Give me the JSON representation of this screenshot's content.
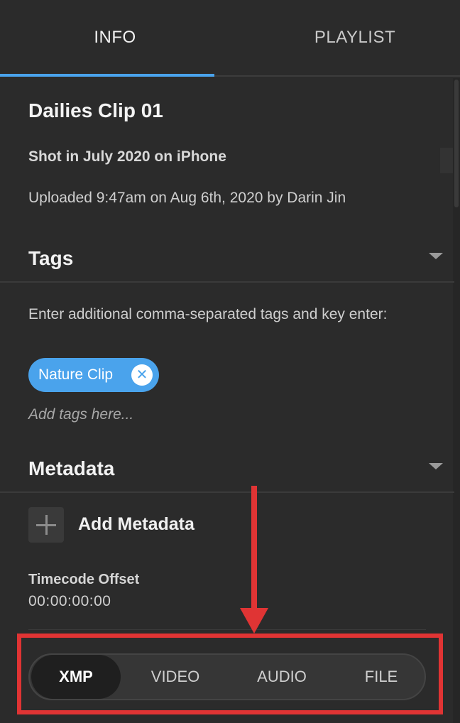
{
  "tabs": [
    {
      "label": "INFO",
      "active": true
    },
    {
      "label": "PLAYLIST",
      "active": false
    }
  ],
  "asset": {
    "title": "Dailies Clip 01",
    "description": "Shot in July 2020 on iPhone",
    "uploaded": "Uploaded 9:47am on Aug 6th, 2020 by Darin Jin"
  },
  "tags": {
    "heading": "Tags",
    "help": "Enter additional comma-separated tags and key enter:",
    "chips": [
      {
        "label": "Nature Clip"
      }
    ],
    "placeholder": "Add tags here..."
  },
  "metadata": {
    "heading": "Metadata",
    "add_label": "Add Metadata",
    "timecode_label": "Timecode Offset",
    "timecode_value": "00:00:00:00",
    "segments": [
      {
        "label": "XMP",
        "active": true
      },
      {
        "label": "VIDEO",
        "active": false
      },
      {
        "label": "AUDIO",
        "active": false
      },
      {
        "label": "FILE",
        "active": false
      }
    ]
  },
  "colors": {
    "accent": "#4aa3ec",
    "background": "#2b2b2b",
    "annotation": "#e03434"
  },
  "icons": [
    "chevron-down-icon",
    "close-circle-icon",
    "plus-icon",
    "arrow-down-icon"
  ]
}
